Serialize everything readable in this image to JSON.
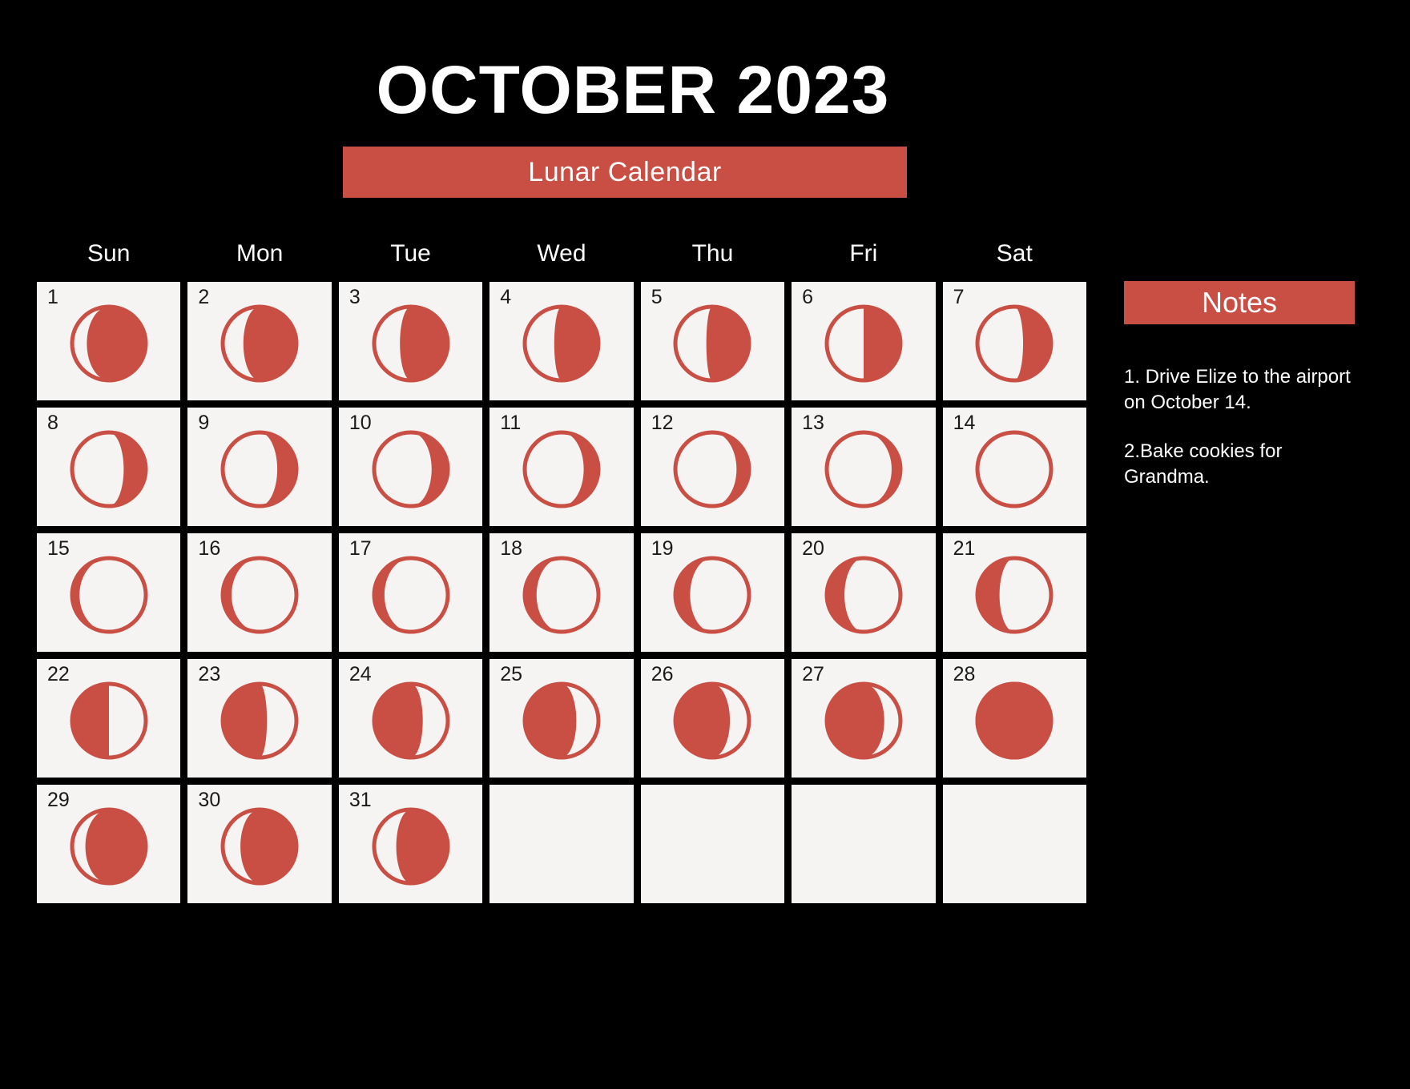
{
  "header": {
    "title": "OCTOBER 2023",
    "subtitle": "Lunar Calendar"
  },
  "colors": {
    "background": "#000000",
    "accent": "#C94E44",
    "cell": "#F5F4F2",
    "text_light": "#FFFFFF",
    "text_dark": "#1A1A1A"
  },
  "weekdays": [
    "Sun",
    "Mon",
    "Tue",
    "Wed",
    "Thu",
    "Fri",
    "Sat"
  ],
  "notes": {
    "heading": "Notes",
    "items": [
      "1. Drive Elize to the airport on October 14.",
      "2.Bake cookies for Grandma."
    ]
  },
  "calendar": {
    "month": "October",
    "year": "2023",
    "start_weekday": "Sun",
    "days_in_month": 31,
    "days": [
      {
        "num": "1",
        "phase": "waning-gibbous",
        "illum": 0.8
      },
      {
        "num": "2",
        "phase": "waning-gibbous",
        "illum": 0.72
      },
      {
        "num": "3",
        "phase": "waning-gibbous",
        "illum": 0.65
      },
      {
        "num": "4",
        "phase": "waning-gibbous",
        "illum": 0.6
      },
      {
        "num": "5",
        "phase": "waning-gibbous",
        "illum": 0.58
      },
      {
        "num": "6",
        "phase": "last-quarter",
        "illum": 0.5
      },
      {
        "num": "7",
        "phase": "waning-crescent",
        "illum": 0.38
      },
      {
        "num": "8",
        "phase": "waning-crescent",
        "illum": 0.3
      },
      {
        "num": "9",
        "phase": "waning-crescent",
        "illum": 0.26
      },
      {
        "num": "10",
        "phase": "waning-crescent",
        "illum": 0.22
      },
      {
        "num": "11",
        "phase": "waning-crescent",
        "illum": 0.2
      },
      {
        "num": "12",
        "phase": "waning-crescent",
        "illum": 0.17
      },
      {
        "num": "13",
        "phase": "waning-crescent",
        "illum": 0.12
      },
      {
        "num": "14",
        "phase": "new-moon",
        "illum": 0.0
      },
      {
        "num": "15",
        "phase": "waxing-crescent",
        "illum": 0.1
      },
      {
        "num": "16",
        "phase": "waxing-crescent",
        "illum": 0.12
      },
      {
        "num": "17",
        "phase": "waxing-crescent",
        "illum": 0.14
      },
      {
        "num": "18",
        "phase": "waxing-crescent",
        "illum": 0.16
      },
      {
        "num": "19",
        "phase": "waxing-crescent",
        "illum": 0.2
      },
      {
        "num": "20",
        "phase": "waxing-crescent",
        "illum": 0.24
      },
      {
        "num": "21",
        "phase": "waxing-crescent",
        "illum": 0.3
      },
      {
        "num": "22",
        "phase": "first-quarter",
        "illum": 0.5
      },
      {
        "num": "23",
        "phase": "waxing-gibbous",
        "illum": 0.6
      },
      {
        "num": "24",
        "phase": "waxing-gibbous",
        "illum": 0.66
      },
      {
        "num": "25",
        "phase": "waxing-gibbous",
        "illum": 0.7
      },
      {
        "num": "26",
        "phase": "waxing-gibbous",
        "illum": 0.74
      },
      {
        "num": "27",
        "phase": "waxing-gibbous",
        "illum": 0.78
      },
      {
        "num": "28",
        "phase": "full-moon",
        "illum": 1.0
      },
      {
        "num": "29",
        "phase": "waning-gibbous",
        "illum": 0.82
      },
      {
        "num": "30",
        "phase": "waning-gibbous",
        "illum": 0.76
      },
      {
        "num": "31",
        "phase": "waning-gibbous",
        "illum": 0.7
      }
    ]
  }
}
